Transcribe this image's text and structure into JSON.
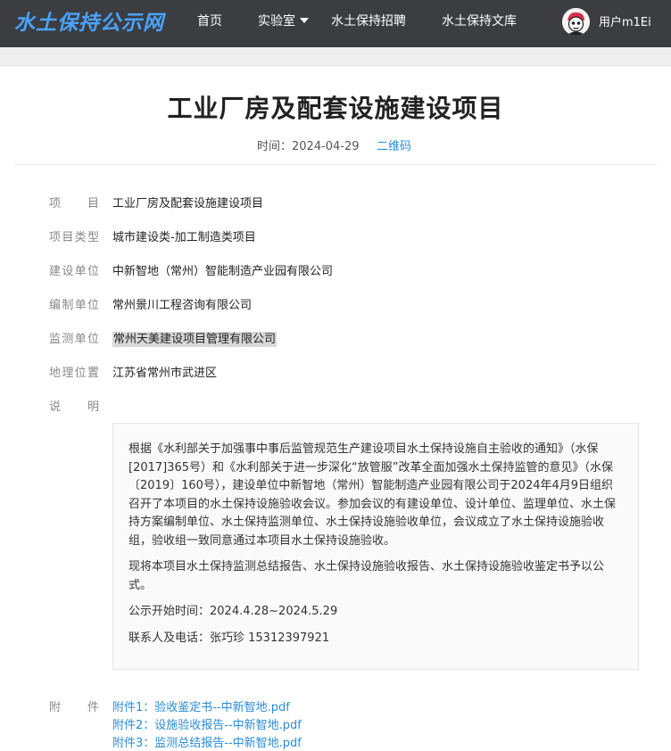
{
  "nav": {
    "logo": "水土保持公示网",
    "items": [
      "首页",
      "实验室",
      "水土保持招聘",
      "水土保持文库"
    ],
    "user": "用户m1Ei"
  },
  "article": {
    "title": "工业厂房及配套设施建设项目",
    "time": "时间：2024-04-29",
    "qrcode": "二维码"
  },
  "fields": [
    {
      "label": "项　目",
      "value": "工业厂房及配套设施建设项目"
    },
    {
      "label": "项目类型",
      "value": "城市建设类-加工制造类项目"
    },
    {
      "label": "建设单位",
      "value": "中新智地（常州）智能制造产业园有限公司"
    },
    {
      "label": "编制单位",
      "value": "常州景川工程咨询有限公司"
    },
    {
      "label": "监测单位",
      "value": "常州天美建设项目管理有限公司"
    },
    {
      "label": "地理位置",
      "value": "江苏省常州市武进区"
    },
    {
      "label": "说　明",
      "value": ""
    }
  ],
  "description": [
    "根据《水利部关于加强事中事后监管规范生产建设项目水土保持设施自主验收的通知》（水保[2017]365号）和《水利部关于进一步深化“放管服”改革全面加强水土保持监管的意见》（水保〔2019〕160号），建设单位中新智地（常州）智能制造产业园有限公司于2024年4月9日组织召开了本项目的水土保持设施验收会议。参加会议的有建设单位、设计单位、监理单位、水土保持方案编制单位、水土保持监测单位、水土保持设施验收单位，会议成立了水土保持设施验收组，验收组一致同意通过本项目水土保持设施验收。",
    "现将本项目水土保持监测总结报告、水土保持设施验收报告、水土保持设施验收鉴定书予以公式。",
    "公示开始时间：2024.4.28~2024.5.29",
    "联系人及电话：张巧珍 15312397921"
  ],
  "attachments": {
    "label": "附　件",
    "items": [
      "附件1：验收鉴定书--中新智地.pdf",
      "附件2：设施验收报告--中新智地.pdf",
      "附件3：监测总结报告--中新智地.pdf"
    ]
  }
}
